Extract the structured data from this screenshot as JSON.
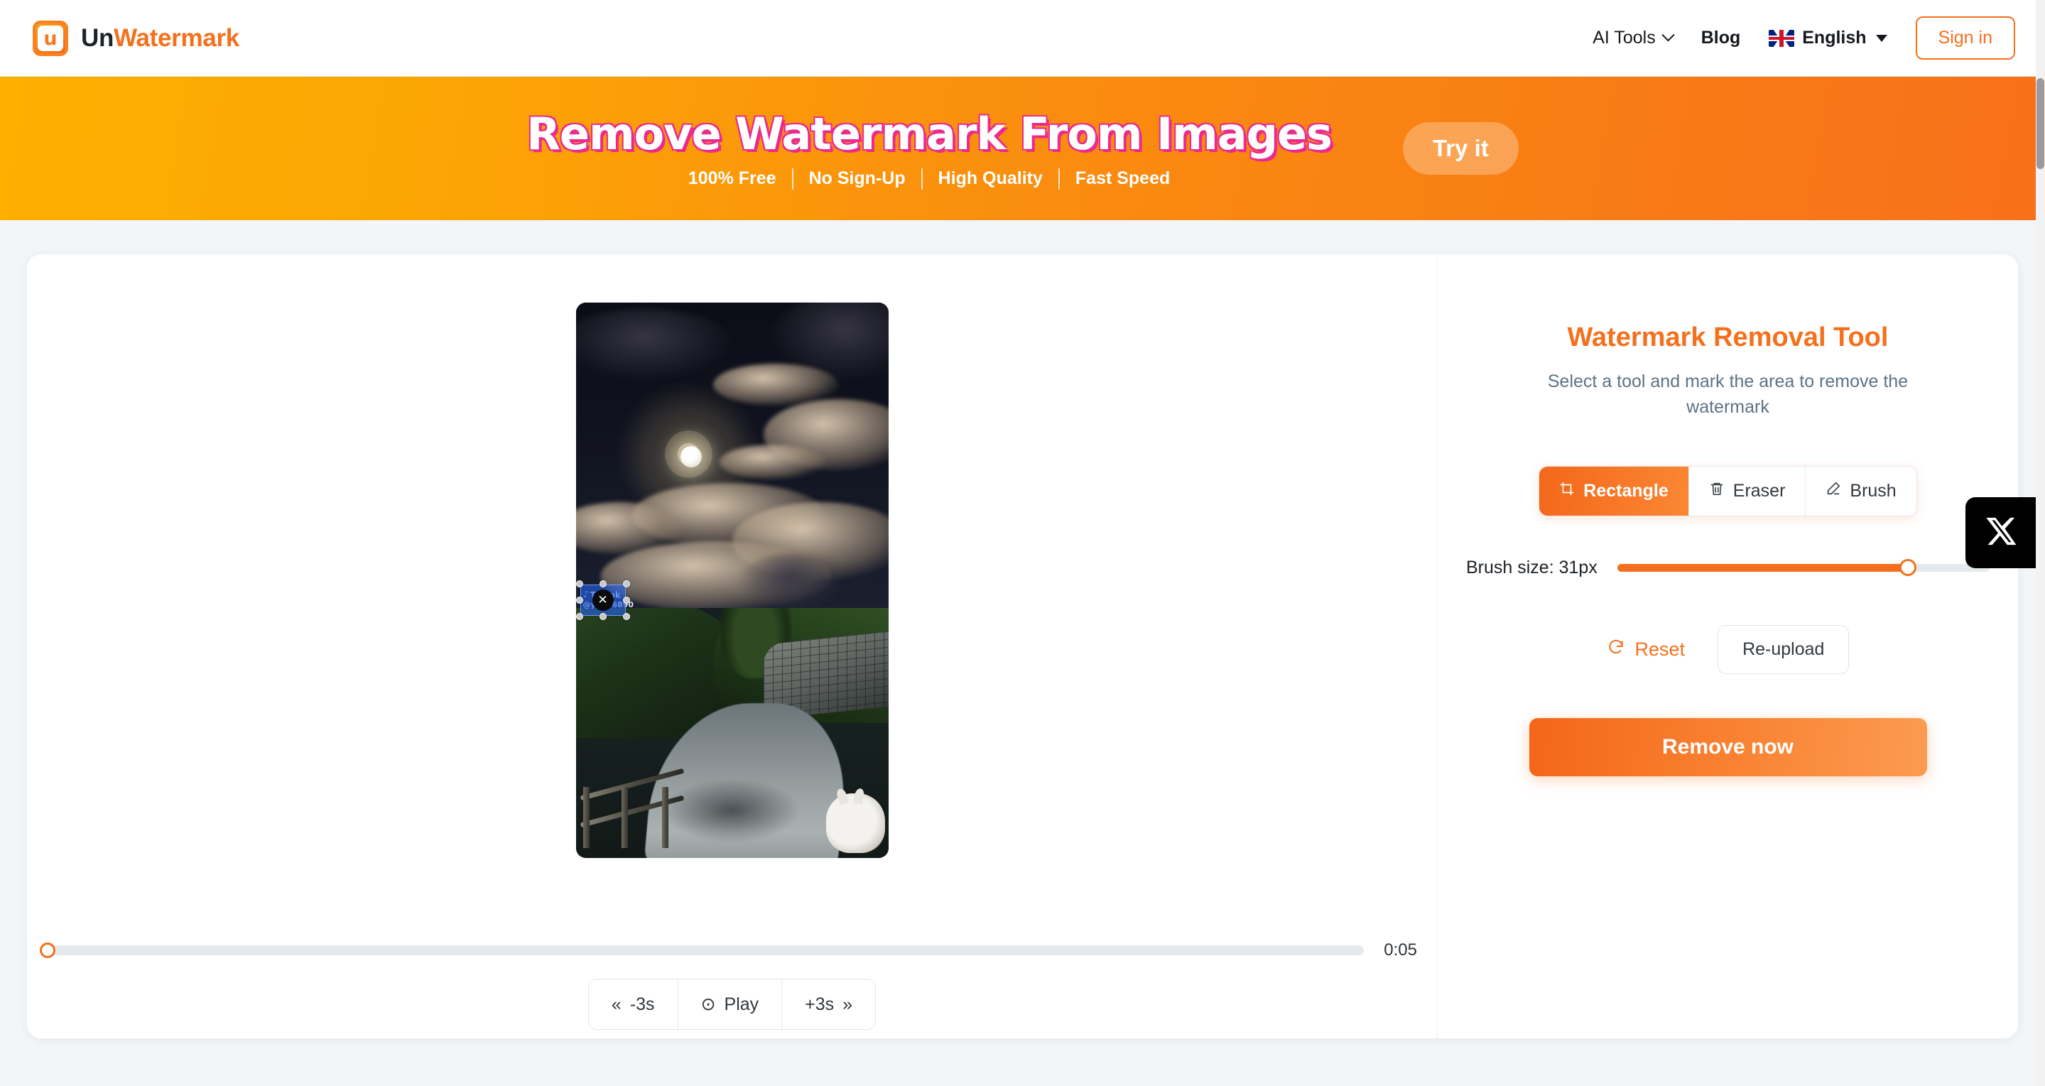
{
  "header": {
    "logo": {
      "prefix": "Un",
      "suffix": "Watermark",
      "mark_glyph": "u",
      "mark_icon": "document-u-icon"
    },
    "nav": [
      {
        "label": "AI Tools",
        "icon": "chevron-down-icon",
        "bold": false
      },
      {
        "label": "Blog",
        "bold": true
      }
    ],
    "language": {
      "label": "English",
      "flag": "uk-flag-icon",
      "caret": "caret-down-icon"
    },
    "sign_in": "Sign in"
  },
  "banner": {
    "title": "Remove Watermark From Images",
    "features": [
      "100% Free",
      "No Sign-Up",
      "High Quality",
      "Fast Speed"
    ],
    "cta": "Try it",
    "gradient_from": "#FDB000",
    "gradient_to": "#F7701A",
    "title_shadow_color": "#EC2A8E"
  },
  "editor": {
    "media": {
      "type": "video-frame",
      "description": "Night country lane under a full moon with illuminated clouds, wooden fence, stone wall and a white goat"
    },
    "watermark_selection": {
      "brand": "TikTok",
      "handle": "@yomi6890",
      "note_icon": "tiktok-note-icon",
      "delete_icon": "close-icon",
      "fill_color": "#2563EB",
      "handles": 8
    },
    "timeline": {
      "position_seconds": 0,
      "progress_percent": 0,
      "duration": "0:05"
    },
    "transport": [
      {
        "label": "-3s",
        "icon": "rewind-icon",
        "icon_glyph": "«",
        "icon_side": "left"
      },
      {
        "label": "Play",
        "icon": "play-circle-icon",
        "icon_glyph": "⊙",
        "icon_side": "left"
      },
      {
        "label": "+3s",
        "icon": "forward-icon",
        "icon_glyph": "»",
        "icon_side": "right"
      }
    ]
  },
  "panel": {
    "title": "Watermark Removal Tool",
    "subtitle": "Select a tool and mark the area to remove the watermark",
    "tools": [
      {
        "label": "Rectangle",
        "icon": "crop-rectangle-icon",
        "active": true
      },
      {
        "label": "Eraser",
        "icon": "trash-icon",
        "active": false
      },
      {
        "label": "Brush",
        "icon": "pencil-icon",
        "active": false
      }
    ],
    "brush": {
      "label": "Brush size: 31px",
      "value": 31,
      "fill_percent": 78
    },
    "reset": {
      "label": "Reset",
      "icon": "refresh-icon"
    },
    "reupload": {
      "label": "Re-upload"
    },
    "primary_action": {
      "label": "Remove now"
    },
    "accent_color": "#F4701D",
    "subtitle_color": "#5B7386"
  },
  "floating": {
    "x_widget": {
      "icon": "x-twitter-icon",
      "background": "#000000"
    }
  }
}
